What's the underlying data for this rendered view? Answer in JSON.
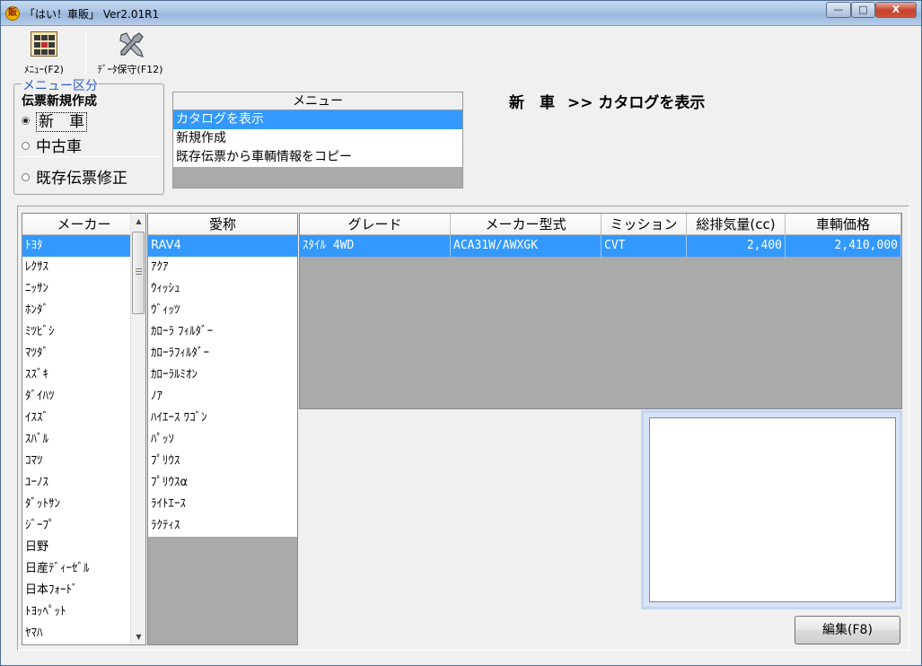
{
  "window": {
    "title": "「はい！車販」 Ver2.01R1",
    "app_icon_glyph": "販",
    "minimize": "—",
    "maximize": "□",
    "close": "X"
  },
  "toolbar": {
    "menu_label": "ﾒﾆｭｰ(F2)",
    "save_label": "ﾃﾞｰﾀ保守(F12)"
  },
  "menu_group": {
    "legend": "メニュー区分",
    "subtitle": "伝票新規作成",
    "options": [
      "新　車",
      "中古車",
      "既存伝票修正"
    ],
    "selected": 0
  },
  "menu_list": {
    "header": "メニュー",
    "items": [
      "カタログを表示",
      "新規作成",
      "既存伝票から車輌情報をコピー"
    ],
    "selected": 0
  },
  "status": {
    "part1": "新　車",
    "part2": ">> カタログを表示"
  },
  "maker_list": {
    "header": "メーカー",
    "items": [
      "ﾄﾖﾀ",
      "ﾚｸｻｽ",
      "ﾆｯｻﾝ",
      "ﾎﾝﾀﾞ",
      "ﾐﾂﾋﾞｼ",
      "ﾏﾂﾀﾞ",
      "ｽｽﾞｷ",
      "ﾀﾞｲﾊﾂ",
      "ｲｽｽﾞ",
      "ｽﾊﾞﾙ",
      "ｺﾏﾂ",
      "ﾕｰﾉｽ",
      "ﾀﾞｯﾄｻﾝ",
      "ｼﾞｰﾌﾟ",
      "日野",
      "日産ﾃﾞｨｰｾﾞﾙ",
      "日本ﾌｫｰﾄﾞ",
      "ﾄﾖｯﾍﾟｯﾄ",
      "ﾔﾏﾊ"
    ],
    "selected": 0,
    "scroll_up": "▲",
    "scroll_down": "▼"
  },
  "nickname_list": {
    "header": "愛称",
    "items": [
      "RAV4",
      "ｱｸｱ",
      "ｳｨｯｼｭ",
      "ｳﾞｨｯﾂ",
      "ｶﾛｰﾗ ﾌｨﾙﾀﾞｰ",
      "ｶﾛｰﾗﾌｨﾙﾀﾞｰ",
      "ｶﾛｰﾗﾙﾐｵﾝ",
      "ﾉｱ",
      "ﾊｲｴｰｽ ﾜｺﾞﾝ",
      "ﾊﾟｯｿ",
      "ﾌﾟﾘｳｽ",
      "ﾌﾟﾘｳｽα",
      "ﾗｲﾄｴｰｽ",
      "ﾗｸﾃｨｽ"
    ],
    "selected": 0
  },
  "grade_grid": {
    "columns": [
      "グレード",
      "メーカー型式",
      "ミッション",
      "総排気量(cc)",
      "車輌価格"
    ],
    "rows": [
      [
        "ｽﾀｲﾙ 4WD",
        "ACA31W/AWXGK",
        "CVT",
        "2,400",
        "2,410,000"
      ]
    ]
  },
  "notes": {
    "value": ""
  },
  "edit_button": {
    "label": "編集(F8)"
  }
}
